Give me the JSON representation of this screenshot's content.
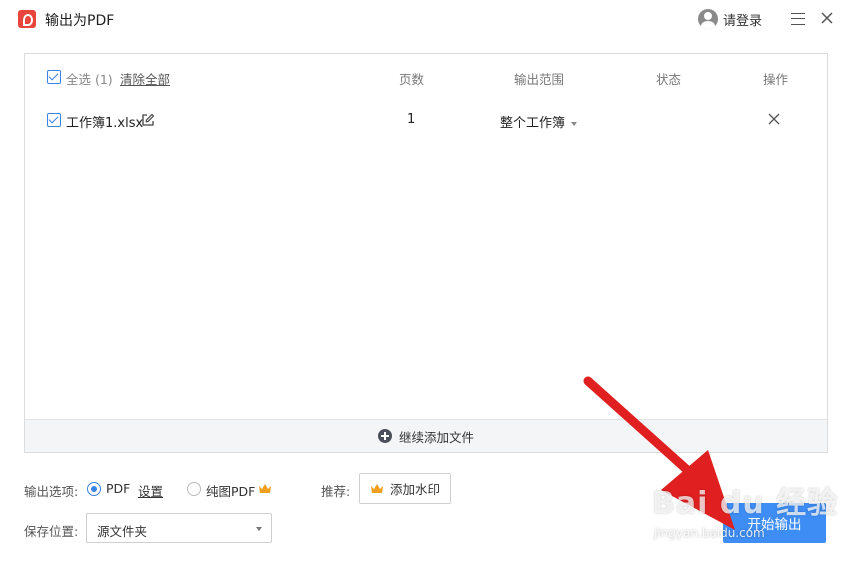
{
  "app": {
    "title": "输出为PDF",
    "login_label": "请登录"
  },
  "header": {
    "select_all": "全选 (1)",
    "clear_all": "清除全部",
    "columns": [
      "页数",
      "输出范围",
      "状态",
      "操作"
    ]
  },
  "files": [
    {
      "name": "工作簿1.xlsx",
      "pages": "1",
      "range": "整个工作簿",
      "status": ""
    }
  ],
  "add_more_label": "继续添加文件",
  "output_options": {
    "label": "输出选项:",
    "pdf_label": "PDF",
    "settings_label": "设置",
    "image_pdf_label": "纯图PDF",
    "selected": "PDF"
  },
  "recommend": {
    "label": "推荐:",
    "watermark_label": "添加水印"
  },
  "save_location": {
    "label": "保存位置:",
    "value": "源文件夹"
  },
  "start_button_label": "开始输出",
  "watermark": {
    "brand": "Bai du 经验",
    "url": "jingyan.baidu.com"
  },
  "colors": {
    "accent": "#3d8df5",
    "crown": "#f0a020",
    "arrow": "#e02020"
  }
}
